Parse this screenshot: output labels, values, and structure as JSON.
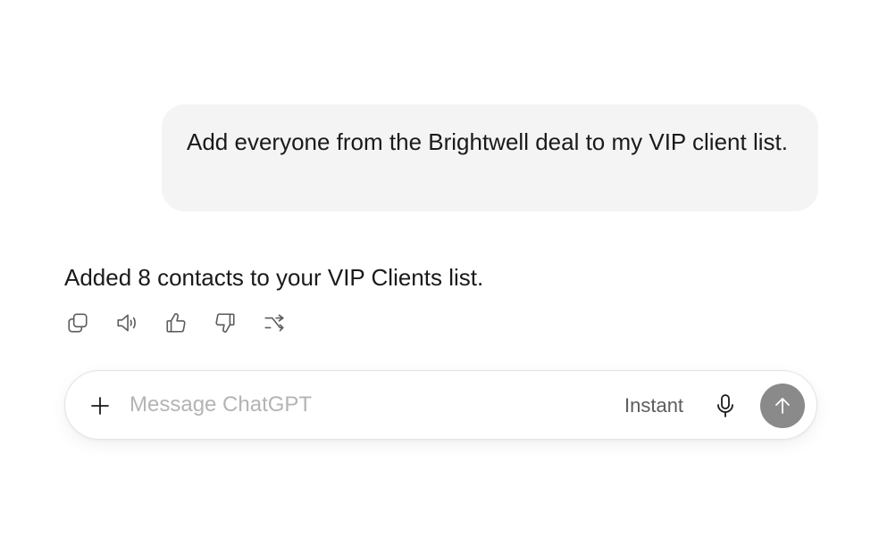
{
  "conversation": {
    "user_message": "Add everyone from the Brightwell deal to my VIP client list.",
    "assistant_message": "Added 8 contacts to your VIP Clients list."
  },
  "message_actions": {
    "icons": [
      "copy-icon",
      "speaker-icon",
      "thumbs-up-icon",
      "thumbs-down-icon",
      "regenerate-icon"
    ]
  },
  "composer": {
    "placeholder": "Message ChatGPT",
    "value": "",
    "mode_label": "Instant",
    "icons": [
      "plus-icon",
      "microphone-icon",
      "arrow-up-icon"
    ]
  },
  "colors": {
    "user_bubble_bg": "#f4f4f4",
    "send_button_bg": "#8a8a8a",
    "icon_color": "#5d5d5d",
    "placeholder_color": "#b4b4b4"
  }
}
